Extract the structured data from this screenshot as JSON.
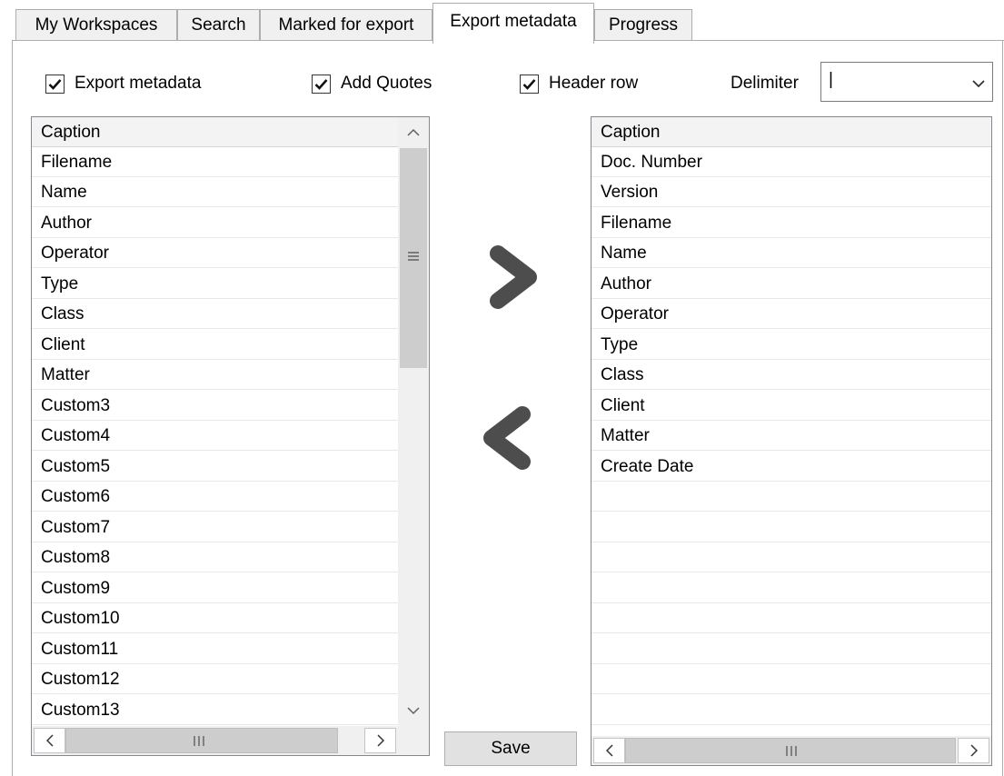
{
  "tabs": [
    {
      "label": "My Workspaces",
      "active": false
    },
    {
      "label": "Search",
      "active": false
    },
    {
      "label": "Marked for export",
      "active": false
    },
    {
      "label": "Export metadata",
      "active": true
    },
    {
      "label": "Progress",
      "active": false
    }
  ],
  "options": {
    "export_metadata": {
      "label": "Export metadata",
      "checked": true
    },
    "add_quotes": {
      "label": "Add Quotes",
      "checked": true
    },
    "header_row": {
      "label": "Header row",
      "checked": true
    },
    "delimiter_label": "Delimiter",
    "delimiter_value": "|"
  },
  "available_list": {
    "header": "Caption",
    "items": [
      "Filename",
      "Name",
      "Author",
      "Operator",
      "Type",
      "Class",
      "Client",
      "Matter",
      "Custom3",
      "Custom4",
      "Custom5",
      "Custom6",
      "Custom7",
      "Custom8",
      "Custom9",
      "Custom10",
      "Custom11",
      "Custom12",
      "Custom13"
    ]
  },
  "selected_list": {
    "header": "Caption",
    "items": [
      "Doc. Number",
      "Version",
      "Filename",
      "Name",
      "Author",
      "Operator",
      "Type",
      "Class",
      "Client",
      "Matter",
      "Create Date"
    ]
  },
  "buttons": {
    "save_label": "Save"
  },
  "icons": {
    "add": "chevron-right-icon",
    "remove": "chevron-left-icon",
    "check": "checkmark-icon",
    "dropdown": "chevron-down-icon",
    "gripper": "scroll-gripper-icon"
  }
}
